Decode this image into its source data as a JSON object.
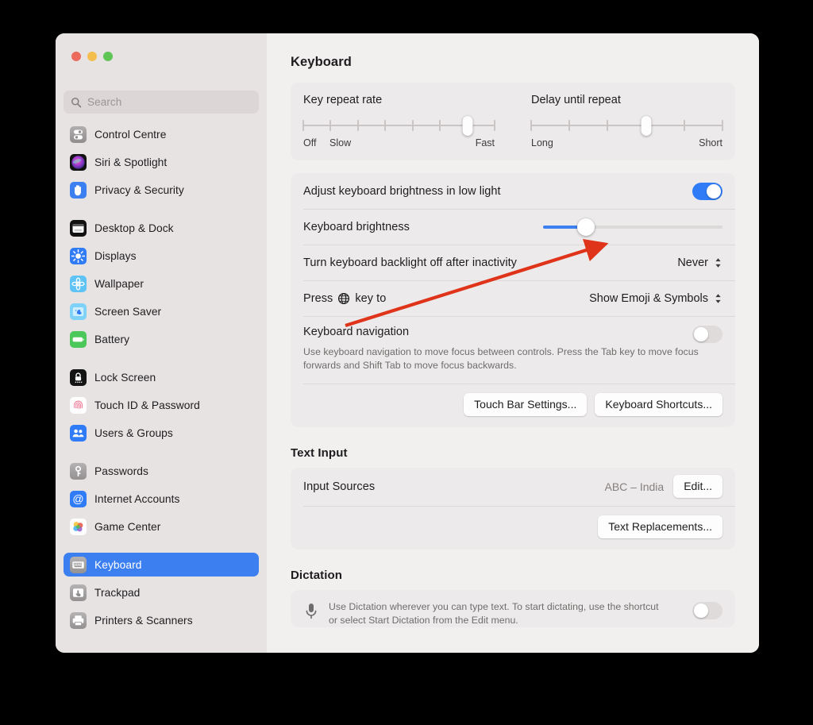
{
  "window": {
    "traffic_lights": [
      {
        "name": "close",
        "color": "#ec6a5e"
      },
      {
        "name": "minimize",
        "color": "#f4bd4f"
      },
      {
        "name": "zoom",
        "color": "#61c555"
      }
    ]
  },
  "sidebar": {
    "search": {
      "placeholder": "Search",
      "value": ""
    },
    "groups": [
      {
        "items": [
          {
            "label": "Control Centre",
            "icon": "control-centre-icon",
            "selected": false
          },
          {
            "label": "Siri & Spotlight",
            "icon": "siri-icon",
            "selected": false
          },
          {
            "label": "Privacy & Security",
            "icon": "privacy-hand-icon",
            "selected": false
          }
        ]
      },
      {
        "items": [
          {
            "label": "Desktop & Dock",
            "icon": "desktop-dock-icon",
            "selected": false
          },
          {
            "label": "Displays",
            "icon": "displays-icon",
            "selected": false
          },
          {
            "label": "Wallpaper",
            "icon": "wallpaper-icon",
            "selected": false
          },
          {
            "label": "Screen Saver",
            "icon": "screen-saver-icon",
            "selected": false
          },
          {
            "label": "Battery",
            "icon": "battery-icon",
            "selected": false
          }
        ]
      },
      {
        "items": [
          {
            "label": "Lock Screen",
            "icon": "lock-screen-icon",
            "selected": false
          },
          {
            "label": "Touch ID & Password",
            "icon": "touch-id-icon",
            "selected": false
          },
          {
            "label": "Users & Groups",
            "icon": "users-groups-icon",
            "selected": false
          }
        ]
      },
      {
        "items": [
          {
            "label": "Passwords",
            "icon": "passwords-key-icon",
            "selected": false
          },
          {
            "label": "Internet Accounts",
            "icon": "internet-accounts-icon",
            "selected": false
          },
          {
            "label": "Game Center",
            "icon": "game-center-icon",
            "selected": false
          }
        ]
      },
      {
        "items": [
          {
            "label": "Keyboard",
            "icon": "keyboard-icon",
            "selected": true
          },
          {
            "label": "Trackpad",
            "icon": "trackpad-icon",
            "selected": false
          },
          {
            "label": "Printers & Scanners",
            "icon": "printer-icon",
            "selected": false
          }
        ]
      }
    ]
  },
  "main": {
    "title": "Keyboard",
    "key_repeat": {
      "left": {
        "title": "Key repeat rate",
        "ticks": 8,
        "value_index": 6,
        "label_start": "Off",
        "label_second": "Slow",
        "label_end": "Fast"
      },
      "right": {
        "title": "Delay until repeat",
        "ticks": 6,
        "value_index": 3,
        "label_start": "Long",
        "label_end": "Short"
      }
    },
    "brightness": {
      "auto_label": "Adjust keyboard brightness in low light",
      "auto_enabled": true,
      "slider_label": "Keyboard brightness",
      "slider_percent": 24,
      "backlight_off_label": "Turn keyboard backlight off after inactivity",
      "backlight_off_value": "Never",
      "globe_label_before": "Press",
      "globe_label_after": "key to",
      "globe_value": "Show Emoji & Symbols",
      "nav_label": "Keyboard navigation",
      "nav_desc": "Use keyboard navigation to move focus between controls. Press the Tab key to move focus forwards and Shift Tab to move focus backwards.",
      "nav_enabled": false,
      "touch_bar_button": "Touch Bar Settings...",
      "shortcuts_button": "Keyboard Shortcuts..."
    },
    "text_input": {
      "section_title": "Text Input",
      "input_sources_label": "Input Sources",
      "input_sources_value": "ABC – India",
      "edit_button": "Edit...",
      "text_replacements_button": "Text Replacements..."
    },
    "dictation": {
      "section_title": "Dictation",
      "desc_line1": "Use Dictation wherever you can type text. To start dictating, use the shortcut",
      "desc_line2": "or select Start Dictation from the Edit menu.",
      "enabled": false
    }
  },
  "annotation": {
    "arrow_color": "#e0341a",
    "from": [
      435,
      410
    ],
    "to": [
      748,
      312
    ]
  }
}
